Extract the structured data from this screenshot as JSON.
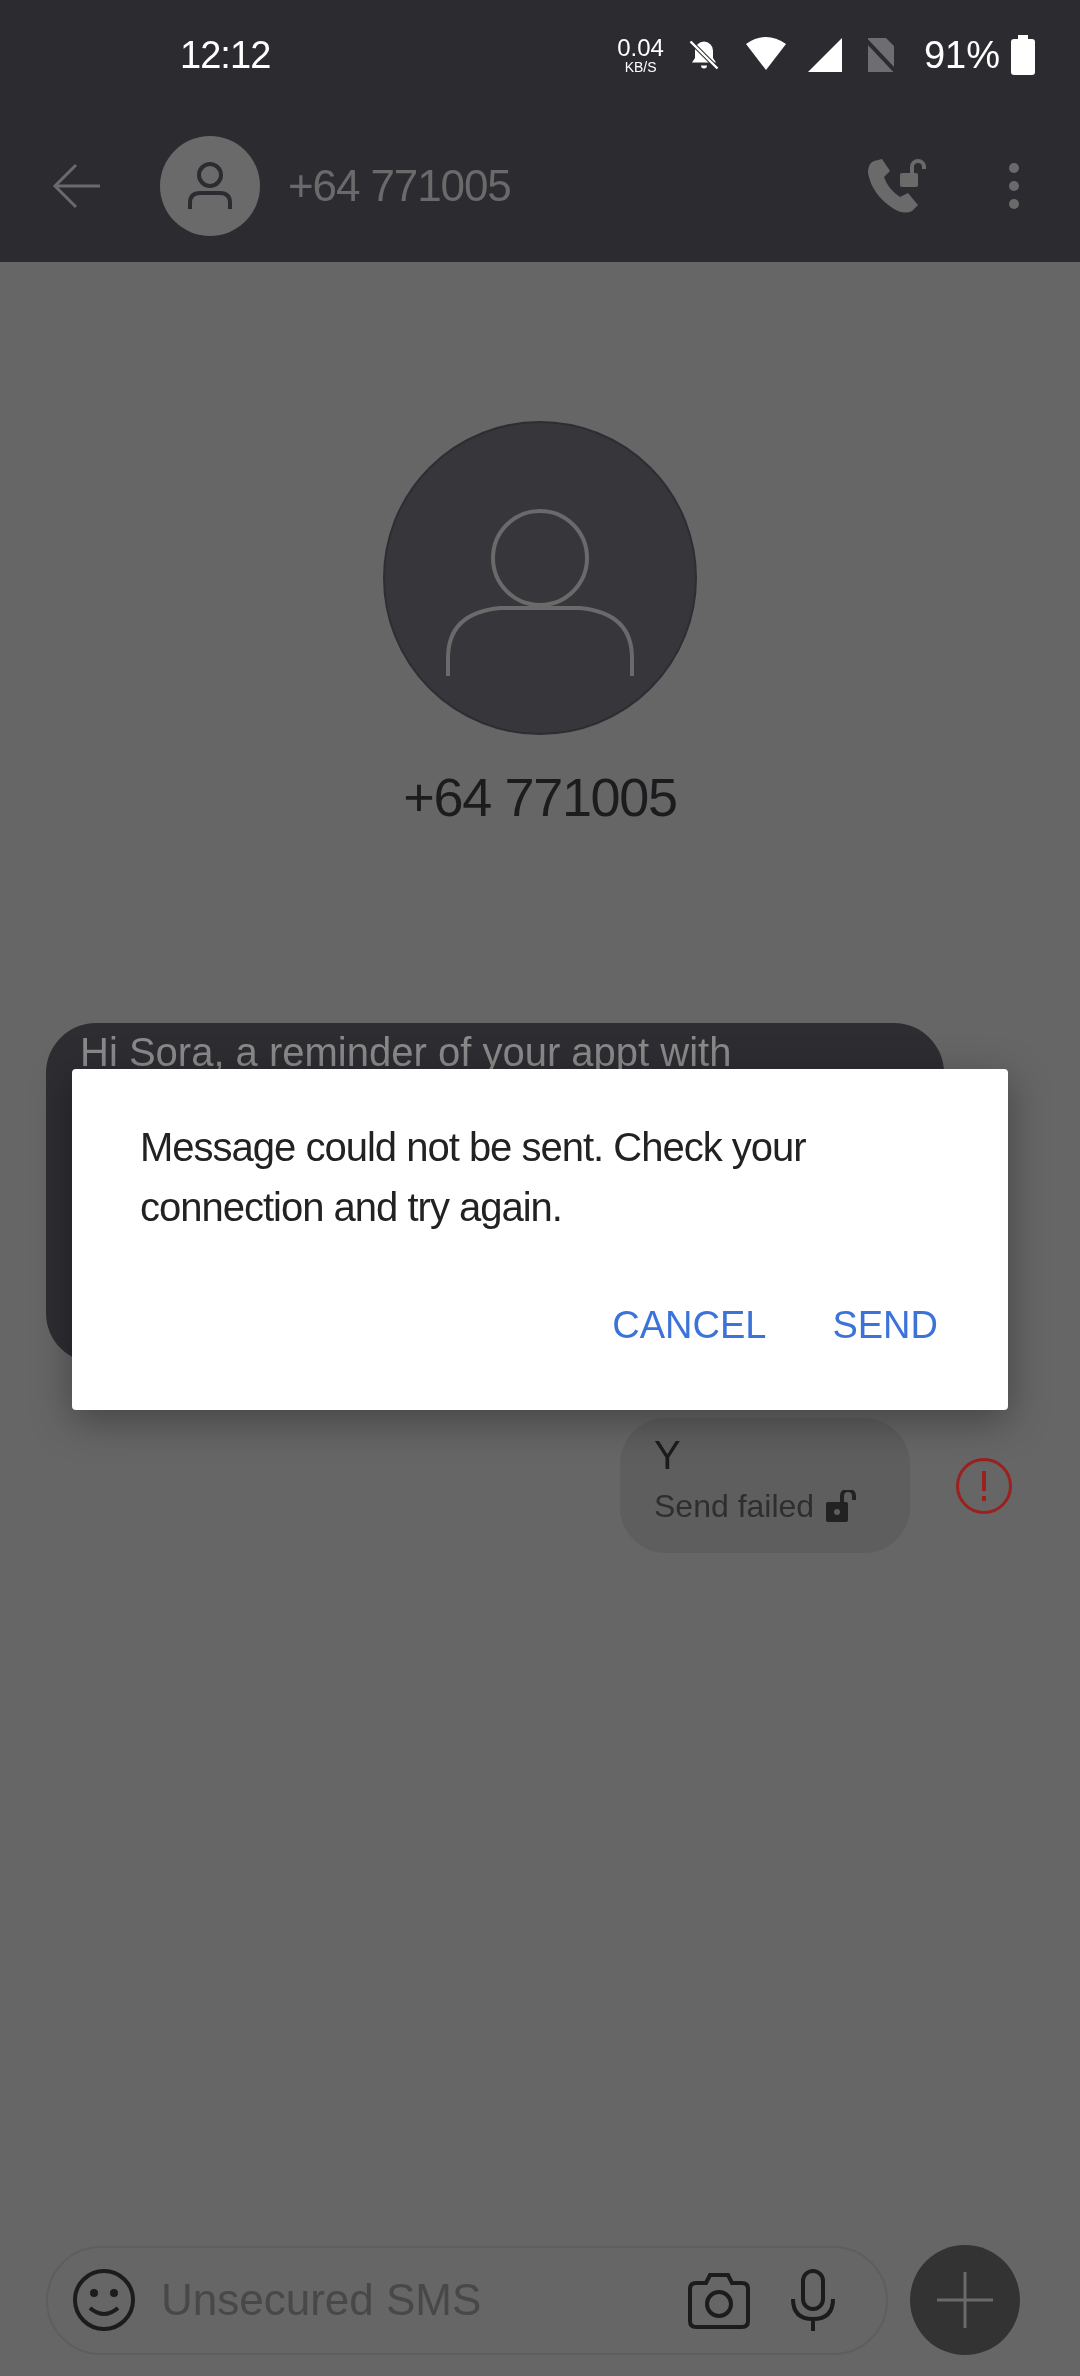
{
  "status_bar": {
    "time": "12:12",
    "net_speed": "0.04",
    "net_unit": "KB/S",
    "battery": "91%"
  },
  "header": {
    "title": "+64 771005"
  },
  "contact": {
    "name": "+64 771005"
  },
  "messages": [
    {
      "kind": "received",
      "text": "Hi Sora, a reminder of your appt with"
    },
    {
      "kind": "sent",
      "text": "Y",
      "status": "Send failed",
      "failed": true
    }
  ],
  "dialog": {
    "message": "Message could not be sent. Check your connection and try again.",
    "buttons": [
      "CANCEL",
      "SEND"
    ]
  },
  "composer": {
    "placeholder": "Unsecured SMS"
  }
}
